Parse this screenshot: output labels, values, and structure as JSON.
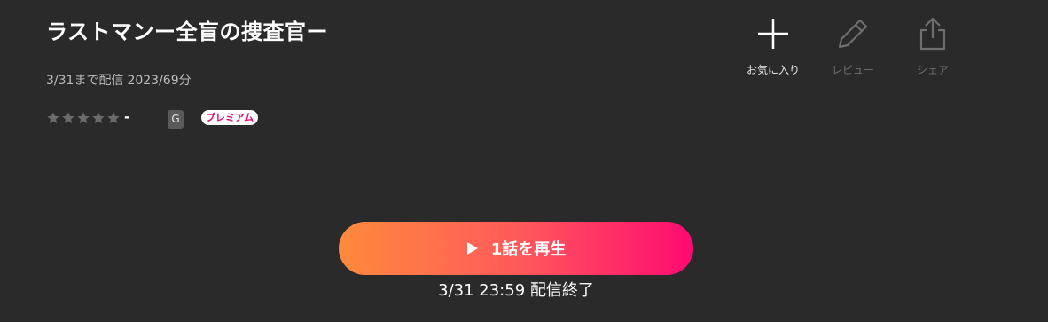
{
  "title": "ラストマンー全盲の捜査官ー",
  "meta": {
    "availability": "3/31まで配信",
    "year_duration": "2023/69分"
  },
  "rating": {
    "stars_filled": 0,
    "stars_total": 5,
    "value": "-"
  },
  "badges": {
    "age": "G",
    "premium": "プレミアム"
  },
  "actions": {
    "favorite": {
      "label": "お気に入り",
      "icon": "plus-icon"
    },
    "review": {
      "label": "レビュー",
      "icon": "pencil-icon"
    },
    "share": {
      "label": "シェア",
      "icon": "share-icon"
    }
  },
  "play": {
    "label": "1話を再生",
    "icon": "play-icon",
    "end_note": "3/31 23:59 配信終了"
  },
  "colors": {
    "background": "#2a2a2a",
    "gradient_start": "#ff8a3d",
    "gradient_end": "#ff0a72",
    "premium_text": "#e5006f",
    "star_empty": "#6b6b6b"
  }
}
